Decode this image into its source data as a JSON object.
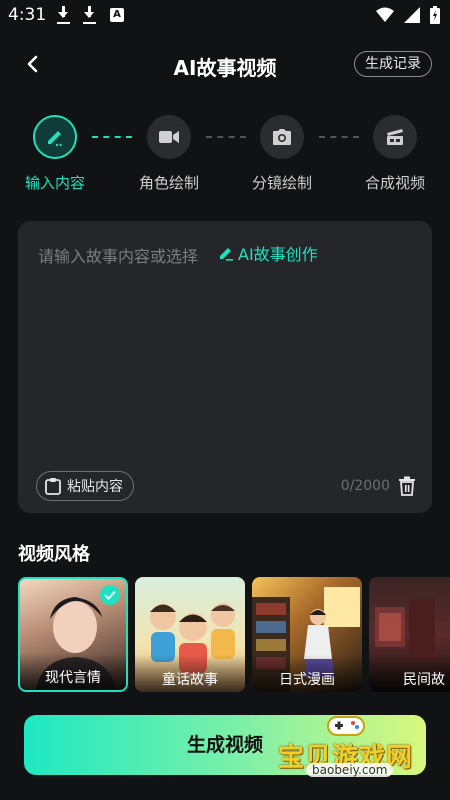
{
  "status_bar": {
    "time": "4:31",
    "a_badge": "A"
  },
  "header": {
    "title": "AI故事视频",
    "history_label": "生成记录"
  },
  "steps": [
    {
      "label": "输入内容",
      "icon": "pencil-icon",
      "active": true
    },
    {
      "label": "角色绘制",
      "icon": "video-camera-icon",
      "active": false
    },
    {
      "label": "分镜绘制",
      "icon": "camera-icon",
      "active": false
    },
    {
      "label": "合成视频",
      "icon": "film-icon",
      "active": false
    }
  ],
  "story_input": {
    "placeholder": "请输入故事内容或选择",
    "ai_create_label": "AI故事创作",
    "paste_label": "粘贴内容",
    "char_count": "0/2000"
  },
  "styles_section": {
    "title": "视频风格",
    "items": [
      {
        "label": "现代言情",
        "selected": true
      },
      {
        "label": "童话故事",
        "selected": false
      },
      {
        "label": "日式漫画",
        "selected": false
      },
      {
        "label": "民间故",
        "selected": false
      }
    ]
  },
  "generate_button": {
    "label": "生成视频"
  },
  "watermark": {
    "text": "宝贝游戏网",
    "url": "baobeiy.com"
  },
  "colors": {
    "accent": "#1fe0bf",
    "background": "#111213",
    "card": "#25262a"
  }
}
